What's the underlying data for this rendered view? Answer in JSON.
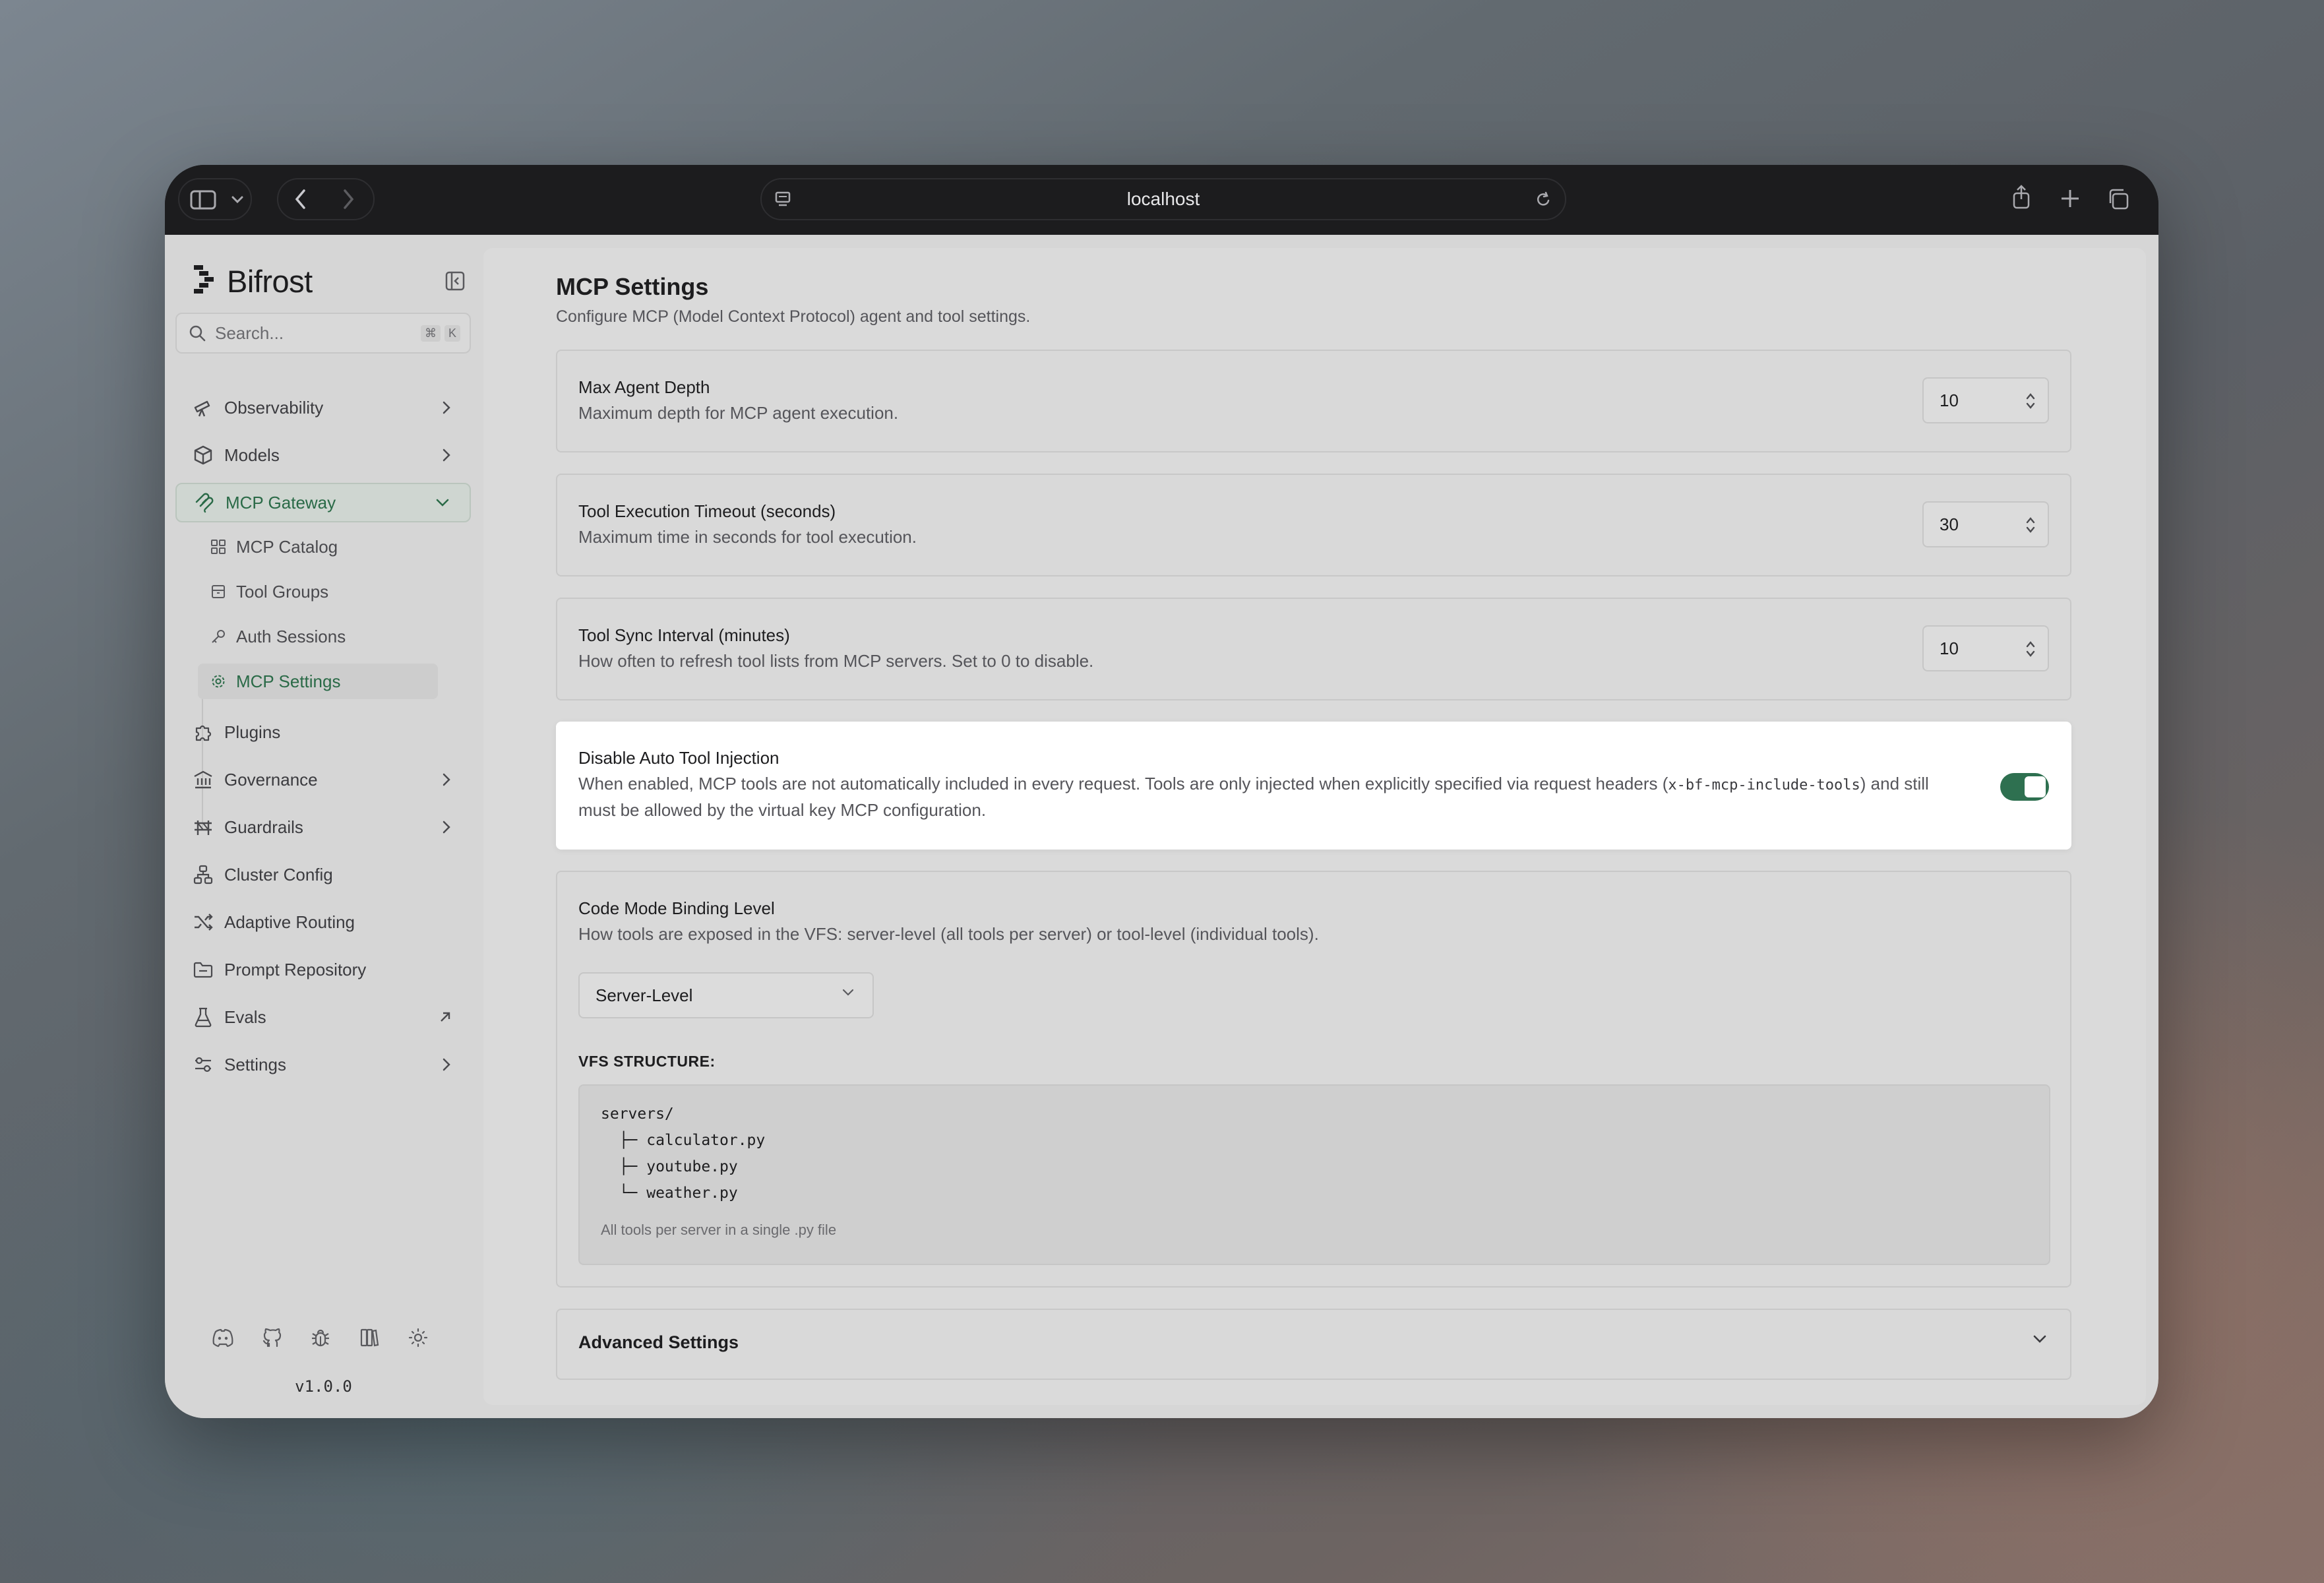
{
  "browser": {
    "url": "localhost"
  },
  "sidebar": {
    "brand": "Bifrost",
    "search": {
      "placeholder": "Search...",
      "shortcut_mod": "⌘",
      "shortcut_key": "K"
    },
    "items": [
      {
        "label": "Observability",
        "icon": "telescope-icon",
        "has_chevron": true
      },
      {
        "label": "Models",
        "icon": "cube-icon",
        "has_chevron": true
      },
      {
        "label": "MCP Gateway",
        "icon": "mcp-icon",
        "has_chevron": true,
        "active": true
      },
      {
        "label": "Plugins",
        "icon": "puzzle-icon"
      },
      {
        "label": "Governance",
        "icon": "landmark-icon",
        "has_chevron": true
      },
      {
        "label": "Guardrails",
        "icon": "guardrails-icon",
        "has_chevron": true
      },
      {
        "label": "Cluster Config",
        "icon": "network-icon"
      },
      {
        "label": "Adaptive Routing",
        "icon": "shuffle-icon"
      },
      {
        "label": "Prompt Repository",
        "icon": "folder-icon"
      },
      {
        "label": "Evals",
        "icon": "flask-icon",
        "external": true
      },
      {
        "label": "Settings",
        "icon": "sliders-icon",
        "has_chevron": true
      }
    ],
    "sub_items": [
      {
        "label": "MCP Catalog",
        "icon": "grid-icon"
      },
      {
        "label": "Tool Groups",
        "icon": "package-icon"
      },
      {
        "label": "Auth Sessions",
        "icon": "key-icon"
      },
      {
        "label": "MCP Settings",
        "icon": "gear-icon",
        "active": true
      }
    ],
    "footer_icons": [
      "discord-icon",
      "github-icon",
      "bug-icon",
      "book-icon",
      "sun-icon"
    ],
    "version": "v1.0.0"
  },
  "main": {
    "title": "MCP Settings",
    "subtitle": "Configure MCP (Model Context Protocol) agent and tool settings.",
    "settings": [
      {
        "title": "Max Agent Depth",
        "description": "Maximum depth for MCP agent execution.",
        "value": "10"
      },
      {
        "title": "Tool Execution Timeout (seconds)",
        "description": "Maximum time in seconds for tool execution.",
        "value": "30"
      },
      {
        "title": "Tool Sync Interval (minutes)",
        "description": "How often to refresh tool lists from MCP servers. Set to 0 to disable.",
        "value": "10"
      }
    ],
    "auto_injection": {
      "title": "Disable Auto Tool Injection",
      "description_pre": "When enabled, MCP tools are not automatically included in every request. Tools are only injected when explicitly specified via request headers (",
      "header_code": "x-bf-mcp-include-tools",
      "description_post": ") and still",
      "description_line2": "must be allowed by the virtual key MCP configuration.",
      "enabled": true,
      "accent": "#2e7050"
    },
    "code_mode": {
      "title": "Code Mode Binding Level",
      "description": "How tools are exposed in the VFS: server-level (all tools per server) or tool-level (individual tools).",
      "selected": "Server-Level",
      "vfs_label": "VFS STRUCTURE:",
      "vfs_lines": [
        "servers/",
        "  ├─ calculator.py",
        "  ├─ youtube.py",
        "  └─ weather.py"
      ],
      "vfs_note": "All tools per server in a single .py file"
    },
    "advanced": {
      "title": "Advanced Settings"
    }
  }
}
